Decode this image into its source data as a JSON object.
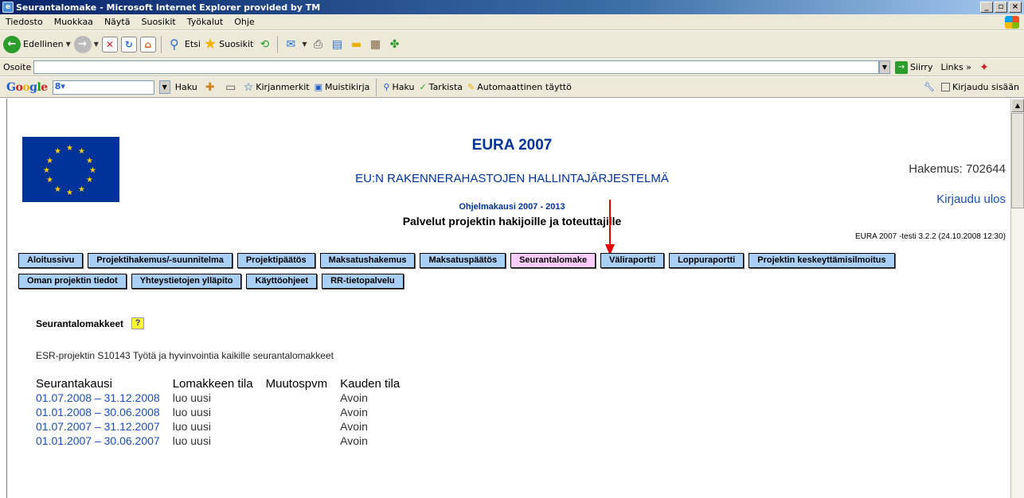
{
  "window": {
    "title": "Seurantalomake - Microsoft Internet Explorer provided by TM",
    "min_label": "_",
    "max_label": "▫",
    "close_label": "×"
  },
  "menu": [
    "Tiedosto",
    "Muokkaa",
    "Näytä",
    "Suosikit",
    "Työkalut",
    "Ohje"
  ],
  "toolbar": {
    "back_label": "Edellinen",
    "search_label": "Etsi",
    "favorites_label": "Suosikit"
  },
  "address": {
    "label": "Osoite",
    "value": "",
    "go_label": "Siirry",
    "links_label": "Links"
  },
  "google": {
    "search_label": "Haku",
    "bookmarks_label": "Kirjanmerkit",
    "notebook_label": "Muistikirja",
    "haku2_label": "Haku",
    "check_label": "Tarkista",
    "autofill_label": "Automaattinen täyttö",
    "signin_label": "Kirjaudu sisään"
  },
  "header": {
    "title": "EURA 2007",
    "subtitle": "EU:N RAKENNERAHASTOJEN HALLINTAJÄRJESTELMÄ",
    "period": "Ohjelmakausi 2007 - 2013",
    "services": "Palvelut projektin hakijoille ja toteuttajille",
    "application": "Hakemus: 702644",
    "logout": "Kirjaudu ulos",
    "version": "EURA 2007 -testi 3.2.2 (24.10.2008 12:30)"
  },
  "nav_row1": [
    {
      "label": "Aloitussivu",
      "active": false
    },
    {
      "label": "Projektihakemus/-suunnitelma",
      "active": false
    },
    {
      "label": "Projektipäätös",
      "active": false
    },
    {
      "label": "Maksatushakemus",
      "active": false
    },
    {
      "label": "Maksatuspäätös",
      "active": false
    },
    {
      "label": "Seurantalomake",
      "active": true
    },
    {
      "label": "Väliraportti",
      "active": false
    },
    {
      "label": "Loppuraportti",
      "active": false
    },
    {
      "label": "Projektin keskeyttämisilmoitus",
      "active": false
    }
  ],
  "nav_row2": [
    {
      "label": "Oman projektin tiedot"
    },
    {
      "label": "Yhteystietojen ylläpito"
    },
    {
      "label": "Käyttöohjeet"
    },
    {
      "label": "RR-tietopalvelu"
    }
  ],
  "section": {
    "title": "Seurantalomakkeet",
    "help": "?",
    "project_line": "ESR-projektin S10143 Työtä ja hyvinvointia kaikille seurantalomakkeet"
  },
  "table": {
    "headers": [
      "Seurantakausi",
      "Lomakkeen tila",
      "Muutospvm",
      "Kauden tila"
    ],
    "rows": [
      {
        "period": "01.07.2008 – 31.12.2008",
        "form_state": "luo uusi",
        "changed": "",
        "period_state": "Avoin"
      },
      {
        "period": "01.01.2008 – 30.06.2008",
        "form_state": "luo uusi",
        "changed": "",
        "period_state": "Avoin"
      },
      {
        "period": "01.07.2007 – 31.12.2007",
        "form_state": "luo uusi",
        "changed": "",
        "period_state": "Avoin"
      },
      {
        "period": "01.01.2007 – 30.06.2007",
        "form_state": "luo uusi",
        "changed": "",
        "period_state": "Avoin"
      }
    ]
  }
}
